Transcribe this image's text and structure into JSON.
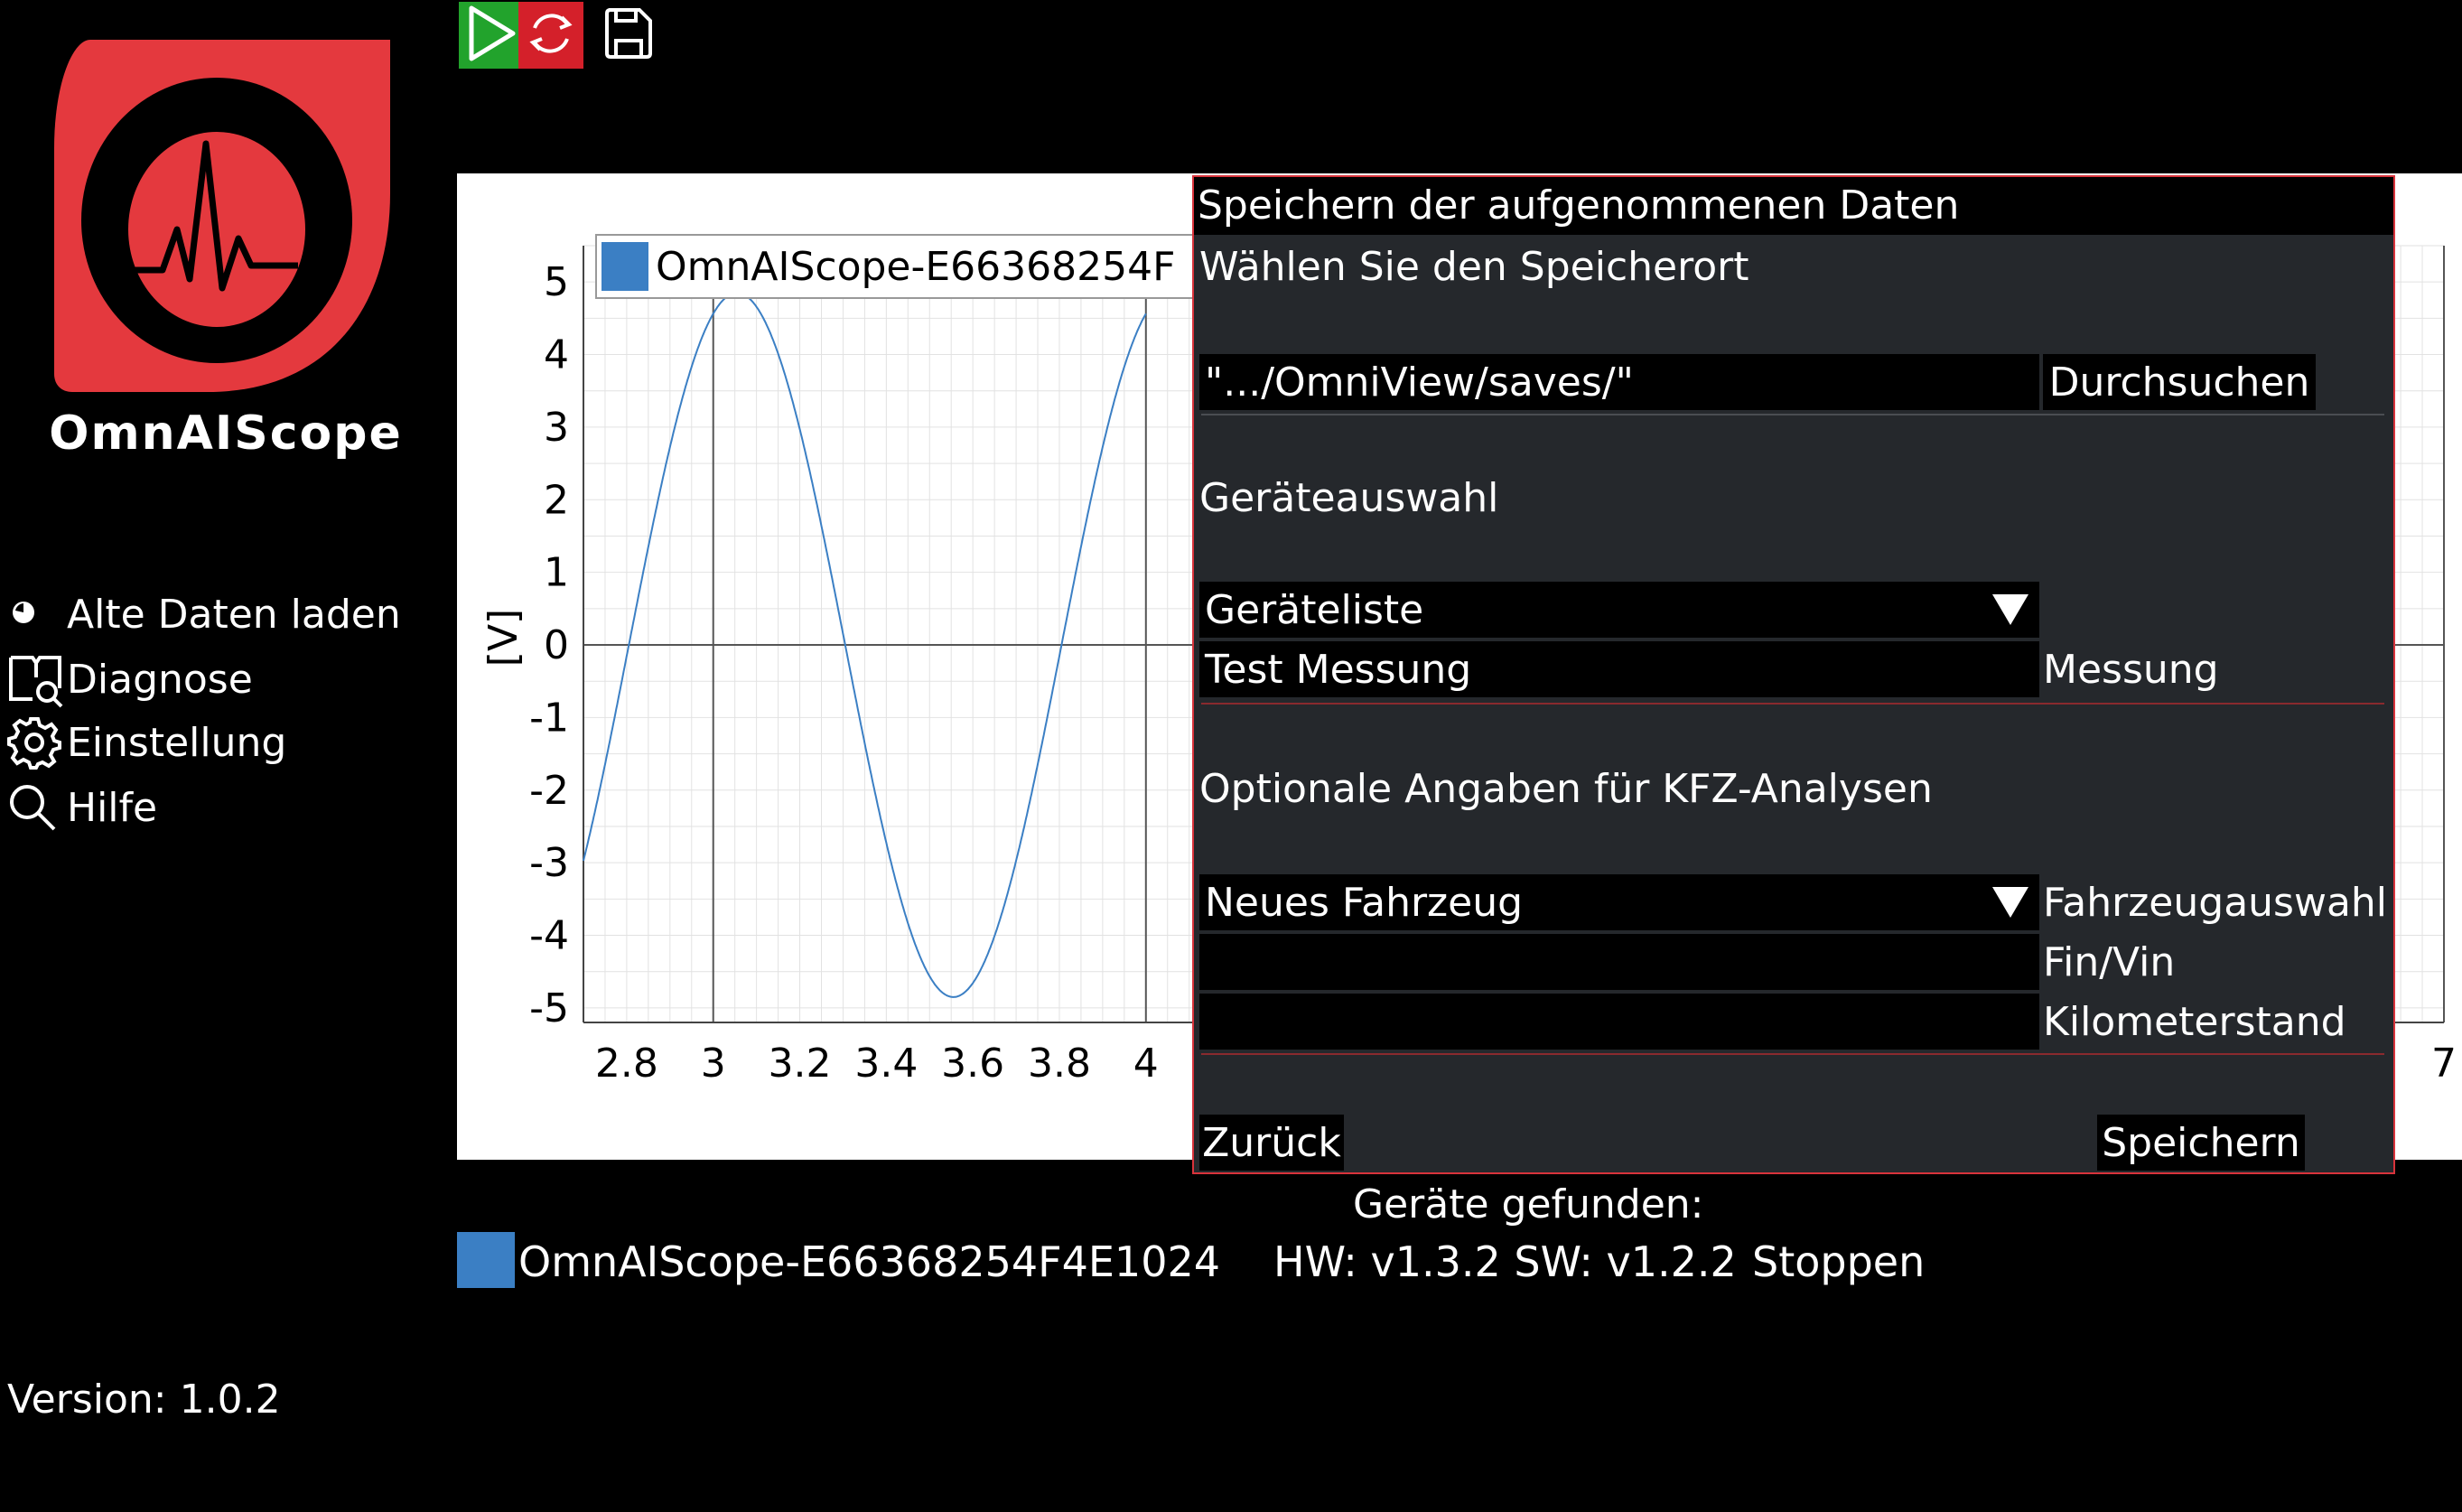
{
  "app": {
    "name": "OmnAIScope",
    "version": "Version: 1.0.2"
  },
  "sidebar": {
    "items": [
      {
        "label": "Alte Daten laden",
        "icon": "load-icon"
      },
      {
        "label": "Diagnose",
        "icon": "diagnose-icon"
      },
      {
        "label": "Einstellung",
        "icon": "gear-icon"
      },
      {
        "label": "Hilfe",
        "icon": "search-icon"
      }
    ]
  },
  "toolbar": {
    "buttons": [
      {
        "name": "play",
        "icon": "play-icon",
        "color": "#22a32c"
      },
      {
        "name": "refresh",
        "icon": "refresh-icon",
        "color": "#d4202a"
      },
      {
        "name": "save",
        "icon": "save-icon"
      }
    ]
  },
  "chart_data": {
    "type": "line",
    "title": "",
    "xlabel": "",
    "ylabel": "[V]",
    "xlim": [
      2.7,
      7.0
    ],
    "ylim": [
      -5.2,
      5.5
    ],
    "x_ticks": [
      "2.8",
      "3",
      "3.2",
      "3.4",
      "3.6",
      "3.8",
      "4",
      "7"
    ],
    "y_ticks": [
      "5",
      "4",
      "3",
      "2",
      "1",
      "0",
      "-1",
      "-2",
      "-3",
      "-4",
      "-5"
    ],
    "grid": true,
    "legend_position": "top-left",
    "series": [
      {
        "name": "OmnAIScope-E66368254F",
        "color": "#3b7fc4",
        "x": [
          2.7,
          2.8,
          2.9,
          3.0,
          3.055,
          3.1,
          3.2,
          3.3,
          3.4,
          3.5,
          3.555,
          3.6,
          3.7,
          3.8,
          3.9,
          4.0
        ],
        "y": [
          -3.0,
          0.6,
          3.5,
          4.7,
          5.0,
          4.7,
          2.8,
          0.0,
          -2.8,
          -4.7,
          -4.8,
          -4.6,
          -2.8,
          0.0,
          2.8,
          4.7
        ]
      }
    ]
  },
  "devices": {
    "found_label": "Geräte gefunden:",
    "items": [
      {
        "name": "OmnAIScope-E66368254F4E1024",
        "version": "HW: v1.3.2 SW: v1.2.2",
        "action": "Stoppen",
        "color": "#3b7fc4"
      }
    ]
  },
  "dialog": {
    "title": "Speichern der aufgenommenen Daten",
    "location_label": "Wählen Sie den Speicherort",
    "path_value": "\".../OmniView/saves/\"",
    "browse_button": "Durchsuchen",
    "device_section_label": "Geräteauswahl",
    "device_select": "Geräteliste",
    "measurement_value": "Test Messung",
    "measurement_label": "Messung",
    "vehicle_section_label": "Optionale Angaben für KFZ-Analysen",
    "vehicle_select": "Neues Fahrzeug",
    "vehicle_label": "Fahrzeugauswahl",
    "vin_value": "",
    "vin_label": "Fin/Vin",
    "km_value": "",
    "km_label": "Kilometerstand",
    "back_button": "Zurück",
    "save_button": "Speichern"
  }
}
